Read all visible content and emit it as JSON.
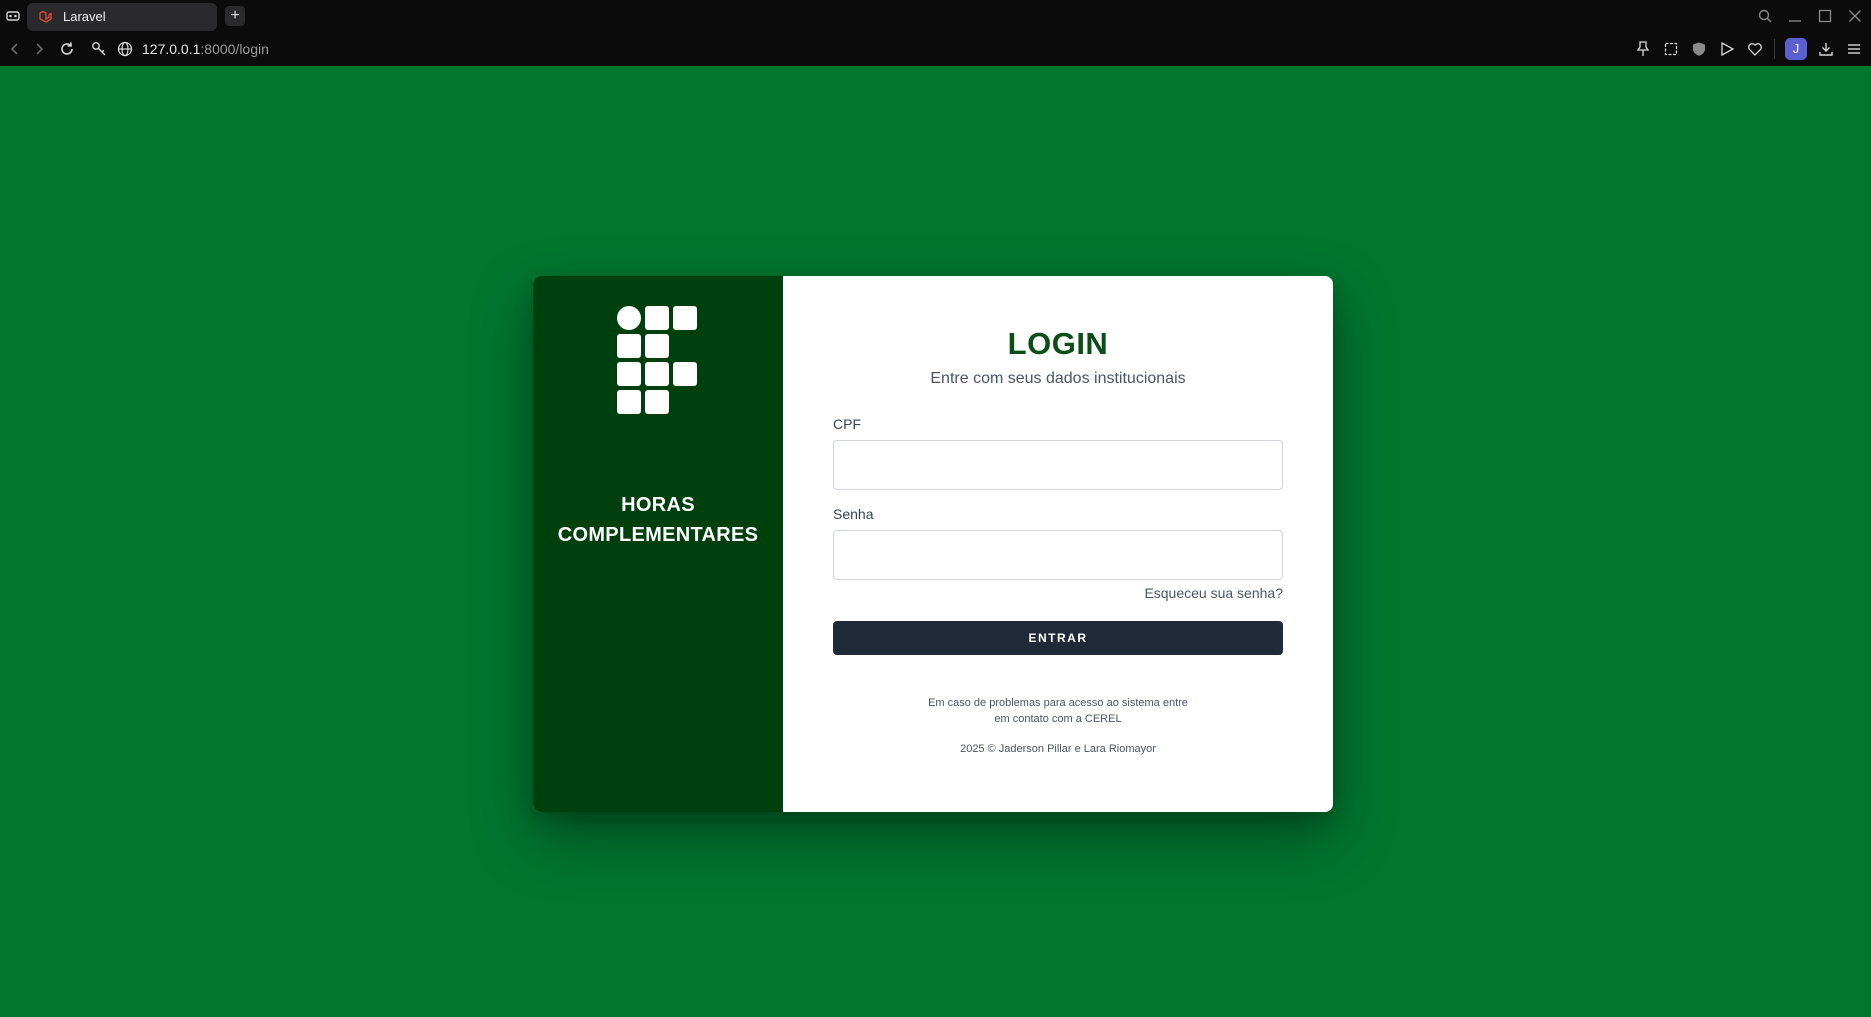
{
  "browser": {
    "tab_title": "Laravel",
    "new_tab_label": "+",
    "url_host": "127.0.0.1",
    "url_rest": ":8000/login",
    "profile_initial": "J",
    "accent": "#5c5fd0"
  },
  "brand": {
    "title_line1": "HORAS",
    "title_line2": "COMPLEMENTARES",
    "panel_color": "#00400e"
  },
  "login": {
    "title": "LOGIN",
    "subtitle": "Entre com seus dados institucionais",
    "cpf_label": "CPF",
    "cpf_value": "",
    "password_label": "Senha",
    "password_value": "",
    "forgot_link": "Esqueceu sua senha?",
    "submit_label": "ENTRAR",
    "help_line1": "Em caso de problemas para acesso ao sistema entre",
    "help_line2": "em contato com a CEREL",
    "copyright": "2025 © Jaderson Pillar e Lara Riomayor"
  },
  "colors": {
    "page_background": "#00762f",
    "button": "#1f2937",
    "heading": "#0b4d17"
  }
}
